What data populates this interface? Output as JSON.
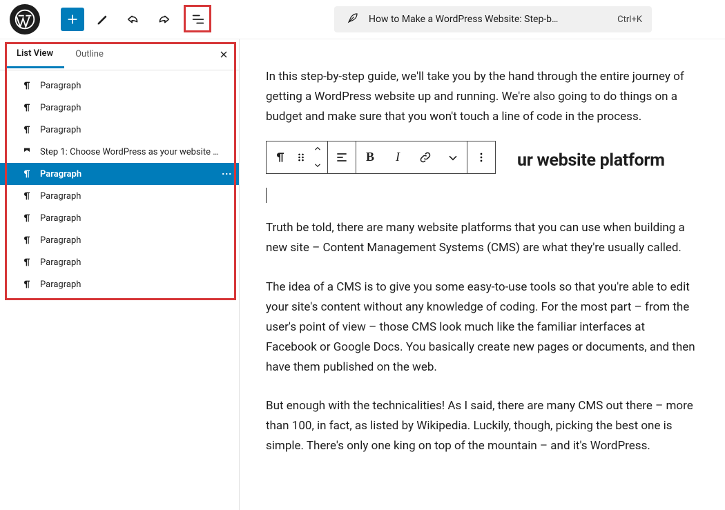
{
  "toolbar": {
    "title": "How to Make a WordPress Website: Step-b…",
    "shortcut": "Ctrl+K"
  },
  "panel": {
    "tabs": {
      "list_view": "List View",
      "outline": "Outline"
    },
    "items": [
      {
        "type": "paragraph",
        "label": "Paragraph"
      },
      {
        "type": "paragraph",
        "label": "Paragraph"
      },
      {
        "type": "paragraph",
        "label": "Paragraph"
      },
      {
        "type": "heading",
        "label": "Step 1: Choose WordPress as your website …"
      },
      {
        "type": "paragraph",
        "label": "Paragraph",
        "selected": true
      },
      {
        "type": "paragraph",
        "label": "Paragraph"
      },
      {
        "type": "paragraph",
        "label": "Paragraph"
      },
      {
        "type": "paragraph",
        "label": "Paragraph"
      },
      {
        "type": "paragraph",
        "label": "Paragraph"
      },
      {
        "type": "paragraph",
        "label": "Paragraph"
      }
    ]
  },
  "content": {
    "p1": "In this step-by-step guide, we'll take you by the hand through the entire journey of getting a WordPress website up and running. We're also going to do things on a budget and make sure that you won't touch a line of code in the process.",
    "h2_visible": "ur website platform",
    "p2": "Truth be told, there are many website platforms that you can use when building a new site – Content Management Systems (CMS) are what they're usually called.",
    "p3": "The idea of a CMS is to give you some easy-to-use tools so that you're able to edit your site's content without any knowledge of coding. For the most part – from the user's point of view – those CMS look much like the familiar interfaces at Facebook or Google Docs. You basically create new pages or documents, and then have them published on the web.",
    "p4": "But enough with the technicalities! As I said, there are many CMS out there – more than 100, in fact, as listed by Wikipedia. Luckily, though, picking the best one is simple. There's only one king on top of the mountain – and it's WordPress."
  }
}
